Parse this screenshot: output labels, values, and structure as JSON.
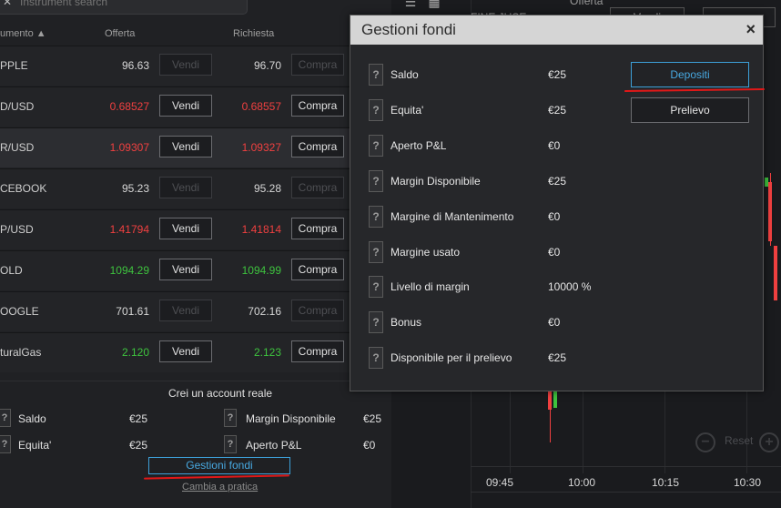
{
  "search": {
    "placeholder": "Instrument search"
  },
  "columns": {
    "instrument": "umento",
    "offer": "Offerta",
    "request": "Richiesta"
  },
  "instruments": [
    {
      "name": "PPLE",
      "bid": "96.63",
      "ask": "96.70",
      "bid_color": "neutral",
      "ask_color": "neutral",
      "enabled": false,
      "selected": false
    },
    {
      "name": "D/USD",
      "bid": "0.68527",
      "ask": "0.68557",
      "bid_color": "red",
      "ask_color": "red",
      "enabled": true,
      "selected": false
    },
    {
      "name": "R/USD",
      "bid": "1.09307",
      "ask": "1.09327",
      "bid_color": "red",
      "ask_color": "red",
      "enabled": true,
      "selected": true
    },
    {
      "name": "CEBOOK",
      "bid": "95.23",
      "ask": "95.28",
      "bid_color": "neutral",
      "ask_color": "neutral",
      "enabled": false,
      "selected": false
    },
    {
      "name": "P/USD",
      "bid": "1.41794",
      "ask": "1.41814",
      "bid_color": "red",
      "ask_color": "red",
      "enabled": true,
      "selected": false
    },
    {
      "name": "OLD",
      "bid": "1094.29",
      "ask": "1094.99",
      "bid_color": "green",
      "ask_color": "green",
      "enabled": true,
      "selected": false
    },
    {
      "name": "OOGLE",
      "bid": "701.61",
      "ask": "702.16",
      "bid_color": "neutral",
      "ask_color": "neutral",
      "enabled": false,
      "selected": false
    },
    {
      "name": "turalGas",
      "bid": "2.120",
      "ask": "2.123",
      "bid_color": "green",
      "ask_color": "green",
      "enabled": true,
      "selected": false
    }
  ],
  "buttons": {
    "sell": "Vendi",
    "buy": "Compra"
  },
  "account": {
    "create_real": "Crei un account reale",
    "saldo_label": "Saldo",
    "saldo_value": "€25",
    "equita_label": "Equita'",
    "equita_value": "€25",
    "margin_label": "Margin Disponibile",
    "margin_value": "€25",
    "pl_label": "Aperto P&L",
    "pl_value": "€0",
    "gestioni_button": "Gestioni fondi",
    "cambia_link": "Cambia a pratica"
  },
  "chart": {
    "x_ticks": [
      "09:45",
      "10:00",
      "10:15",
      "10:30"
    ],
    "reset_label": "Reset",
    "top_label_1": "Offerta",
    "top_label_2": "FINE JUSE",
    "top_btn": "Vendi"
  },
  "modal": {
    "title": "Gestioni fondi",
    "close": "×",
    "rows": [
      {
        "label": "Saldo",
        "value": "€25"
      },
      {
        "label": "Equita'",
        "value": "€25"
      },
      {
        "label": "Aperto P&L",
        "value": "€0"
      },
      {
        "label": "Margin Disponibile",
        "value": "€25"
      },
      {
        "label": "Margine di Mantenimento",
        "value": "€0"
      },
      {
        "label": "Margine usato",
        "value": "€0"
      },
      {
        "label": "Livello di margin",
        "value": "10000 %"
      },
      {
        "label": "Bonus",
        "value": "€0"
      },
      {
        "label": "Disponibile per il prelievo",
        "value": "€25"
      }
    ],
    "deposit_button": "Depositi",
    "withdraw_button": "Prelievo"
  },
  "colors": {
    "accent": "#3da0d8",
    "sell_red": "#f04040",
    "buy_green": "#3ec23e",
    "annotation_red": "#e01818"
  }
}
